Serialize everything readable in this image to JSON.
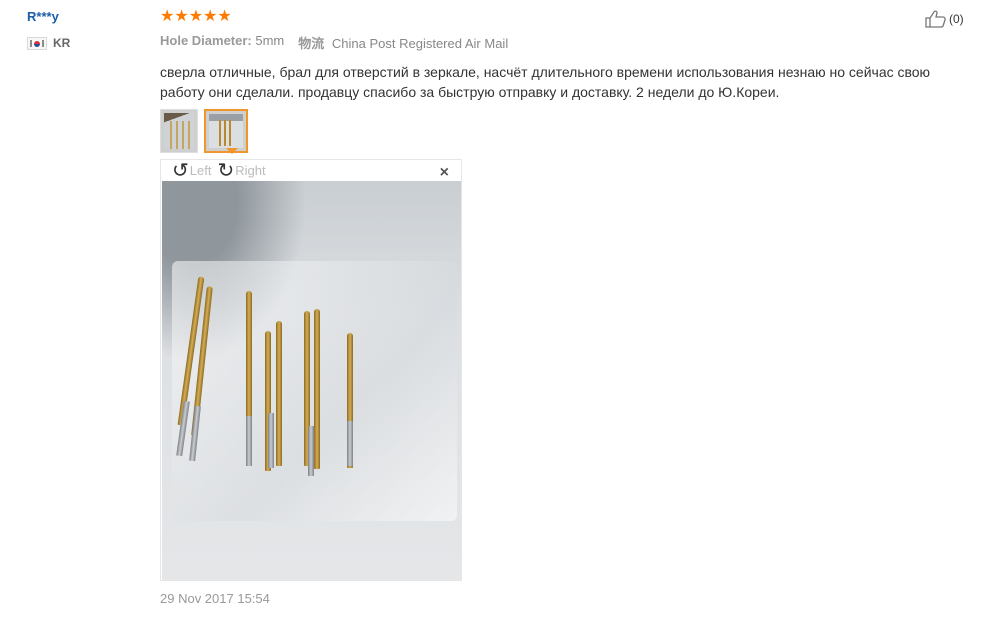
{
  "user": {
    "name": "R***y",
    "country_code": "KR",
    "flag_icon": "kr-flag-icon"
  },
  "review": {
    "rating": 5,
    "stars_display": "★★★★★",
    "attributes": [
      {
        "label": "Hole Diameter:",
        "value": "5mm"
      }
    ],
    "shipping_label": "物流",
    "shipping_value": "China Post Registered Air Mail",
    "text": "сверла отличные, брал для отверстий в зеркале, насчёт длительного времени использования незнаю но сейчас свою работу они сделали. продавцу спасибо за быструю отправку и доставку. 2 недели до Ю.Кореи.",
    "date": "29 Nov 2017 15:54"
  },
  "viewer": {
    "rotate_left_label": "Left",
    "rotate_right_label": "Right",
    "close_glyph": "×"
  },
  "helpful": {
    "count_label": "(0)",
    "icon": "thumbs-up-icon"
  },
  "colors": {
    "accent": "#ff7a00",
    "username": "#1a5da9",
    "thumb_active_border": "#f0962d"
  }
}
